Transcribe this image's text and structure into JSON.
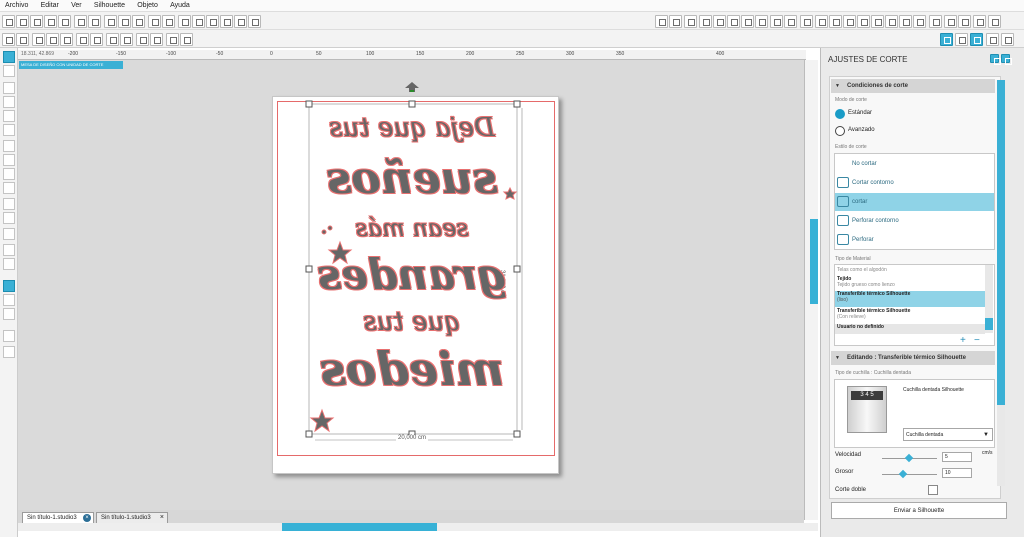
{
  "menu": [
    "Archivo",
    "Editar",
    "Ver",
    "Silhouette",
    "Objeto",
    "Ayuda"
  ],
  "canvas": {
    "registration_label": "MESA DE DISEÑO CON UNIDAD DE CORTE",
    "coords": "18.311, 42.869",
    "ruler_marks": [
      "-200",
      "-150",
      "-100",
      "-50",
      "0",
      "50",
      "100",
      "150",
      "200",
      "250",
      "300",
      "350",
      "400"
    ],
    "width_label": "20,000 cm",
    "height_label": "31,962 cm",
    "design_lines": [
      "Deja que tus",
      "sueños",
      "sean más",
      "grandes",
      "que tus",
      "miedos"
    ]
  },
  "tabs": [
    "Sin título-1.studio3",
    "Sin título-1.studio3"
  ],
  "panel": {
    "title": "AJUSTES DE CORTE",
    "conditions": {
      "title": "Condiciones de corte",
      "mode_label": "Modo de corte",
      "modes": [
        "Estándar",
        "Avanzado"
      ],
      "style_label": "Estilo de corte",
      "styles": [
        "No cortar",
        "Cortar contorno",
        "cortar",
        "Perforar contorno",
        "Perforar"
      ]
    },
    "material": {
      "label": "Tipo de Material",
      "items": [
        {
          "name": "Telas como el algodón",
          "detail": ""
        },
        {
          "name": "Tejido",
          "detail": "Tejido grueso como lienzo"
        },
        {
          "name": "Transferible térmico Silhouette",
          "detail": "(liso)"
        },
        {
          "name": "Transferible térmico Silhouette",
          "detail": "(Con relieve)"
        },
        {
          "name": "Usuario no definido",
          "detail": ""
        }
      ]
    },
    "editing": {
      "title": "Editando : Transferible térmico Silhouette",
      "blade_label": "Tipo de cuchilla : Cuchilla dentada",
      "blade_name": "Cuchilla dentada Silhouette",
      "blade_select": "Cuchilla dentada",
      "speed_label": "Velocidad",
      "speed": "5",
      "speed_unit": "cm/s",
      "thickness_label": "Grosor",
      "thickness": "10",
      "double_cut_label": "Corte doble"
    },
    "send_button": "Enviar a Silhouette"
  }
}
